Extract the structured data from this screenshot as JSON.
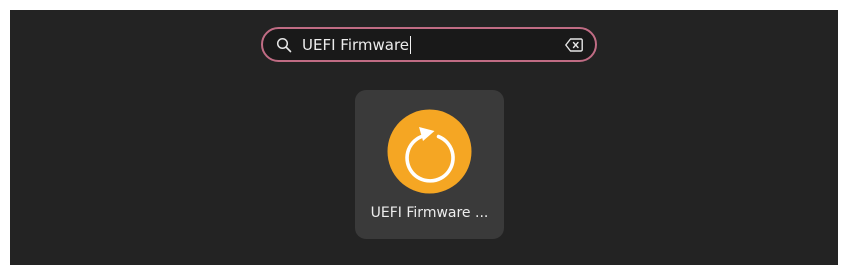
{
  "search": {
    "query": "UEFI Firmware",
    "search_icon": "search-icon",
    "clear_icon": "backspace-clear-icon"
  },
  "results": [
    {
      "label": "UEFI Firmware ...",
      "icon": "refresh-circle-icon",
      "icon_color": "#f5a623"
    }
  ],
  "colors": {
    "background": "#232323",
    "search_border": "#c06c84",
    "tile_background": "#3a3a3a",
    "text": "#ececec"
  }
}
